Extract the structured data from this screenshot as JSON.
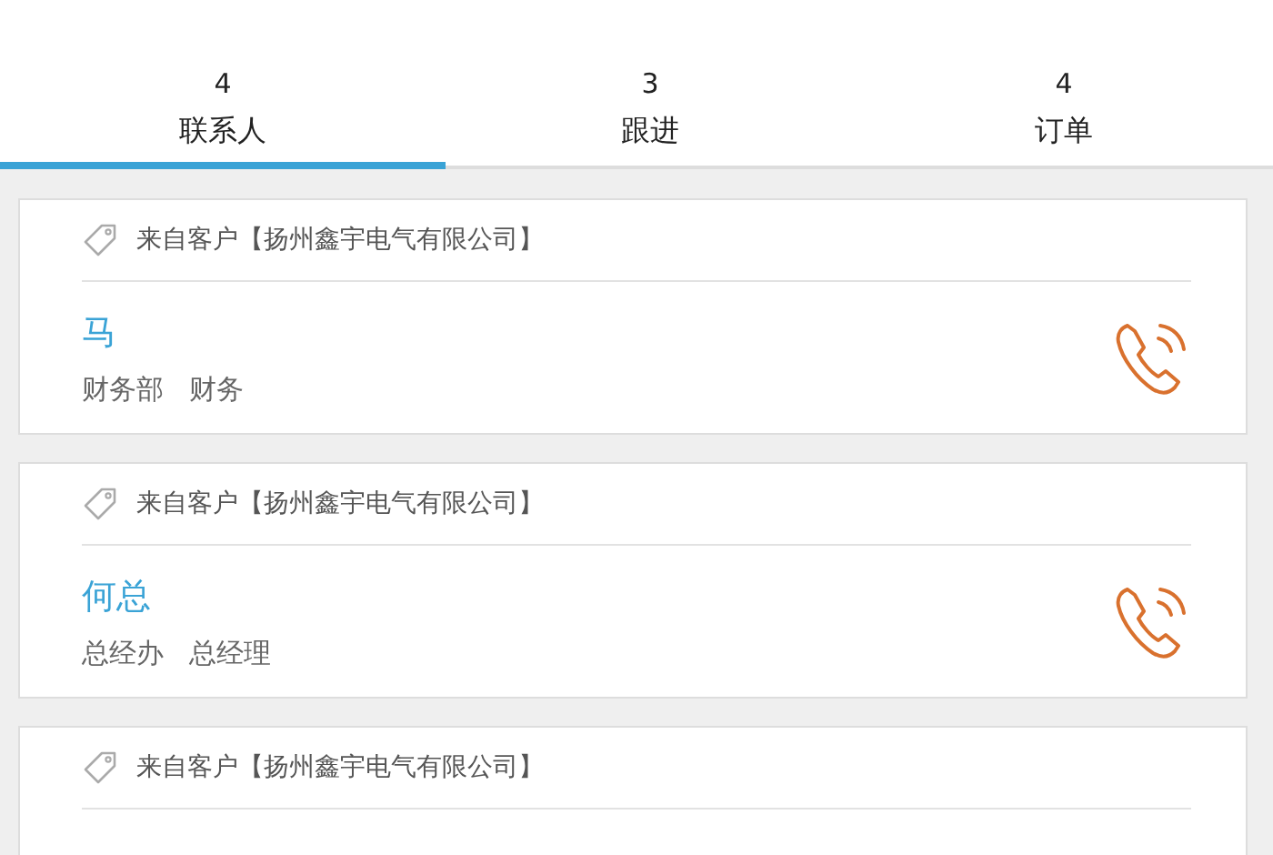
{
  "tabs": [
    {
      "count": "4",
      "label": "联系人",
      "selected": true
    },
    {
      "count": "3",
      "label": "跟进",
      "selected": false
    },
    {
      "count": "4",
      "label": "订单",
      "selected": false
    }
  ],
  "cards": [
    {
      "source": "来自客户【扬州鑫宇电气有限公司】",
      "name": "马",
      "department": "财务部",
      "position": "财务"
    },
    {
      "source": "来自客户【扬州鑫宇电气有限公司】",
      "name": "何总",
      "department": "总经办",
      "position": "总经理"
    },
    {
      "source": "来自客户【扬州鑫宇电气有限公司】"
    }
  ]
}
